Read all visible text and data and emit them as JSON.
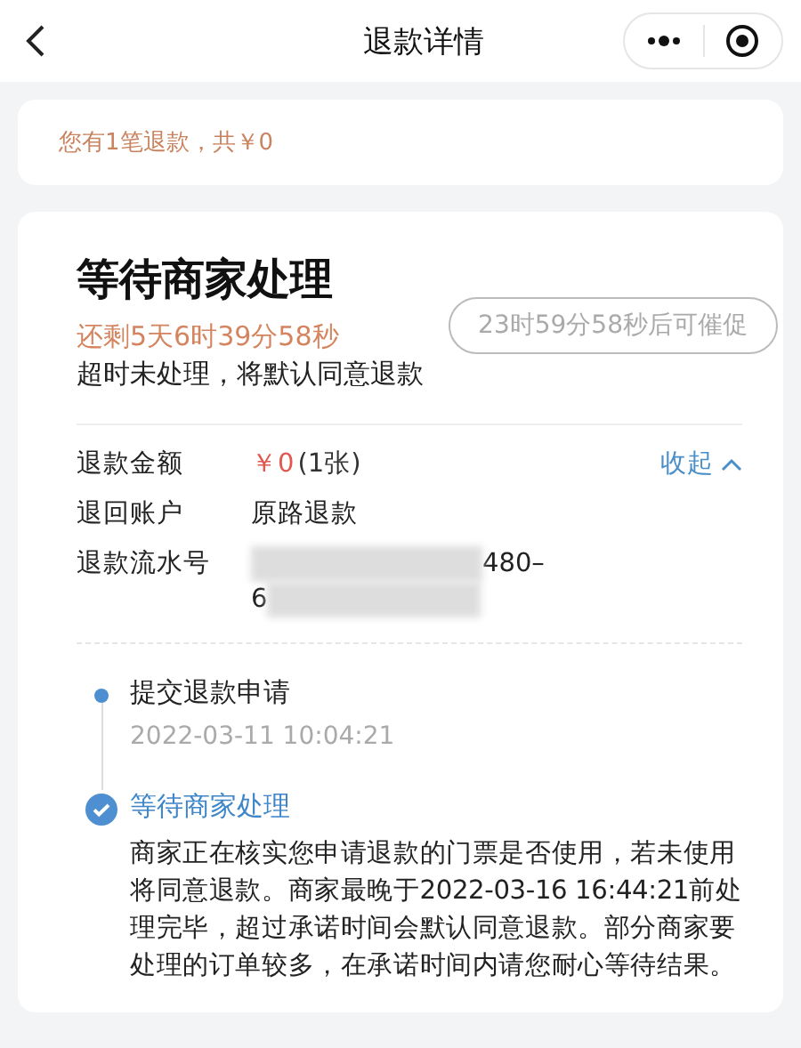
{
  "nav": {
    "title": "退款详情"
  },
  "summary": "您有1笔退款，共￥0",
  "status": {
    "title": "等待商家处理",
    "countdown": "还剩5天6时39分58秒",
    "note": "超时未处理，将默认同意退款",
    "urge_button": {
      "label": "23时59分58秒后可催促",
      "disabled": true
    }
  },
  "details": [
    {
      "label": "退款金额",
      "kind": "amount",
      "amount": "￥0",
      "extra": "(1张)"
    },
    {
      "label": "退回账户",
      "kind": "text",
      "value": "原路退款"
    },
    {
      "label": "退款流水号",
      "kind": "redacted",
      "line_1": "480–",
      "line_2": "6"
    }
  ],
  "collapse_link": {
    "label": "收起",
    "expanded": true
  },
  "timeline": [
    {
      "title": "提交退款申请",
      "current": false,
      "time": "2022-03-11 10:04:21"
    },
    {
      "title": "等待商家处理",
      "current": true,
      "description": "商家正在核实您申请退款的门票是否使用，若未使用将同意退款。商家最晚于2022-03-16 16:44:21前处理完毕，超过承诺时间会默认同意退款。部分商家要处理的订单较多，在承诺时间内请您耐心等待结果。"
    }
  ]
}
